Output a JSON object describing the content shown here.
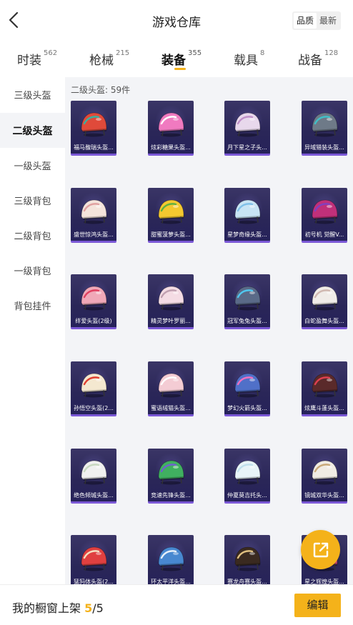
{
  "header": {
    "title": "游戏仓库",
    "sort_options": [
      "品质",
      "最新"
    ],
    "sort_active": "品质",
    "back_icon": "chevron-left-icon"
  },
  "tabs": [
    {
      "label": "时装",
      "count": "562",
      "active": false
    },
    {
      "label": "枪械",
      "count": "215",
      "active": false
    },
    {
      "label": "装备",
      "count": "355",
      "active": true
    },
    {
      "label": "载具",
      "count": "8",
      "active": false
    },
    {
      "label": "战备",
      "count": "128",
      "active": false
    }
  ],
  "sidebar": {
    "items": [
      {
        "label": "三级头盔",
        "active": false
      },
      {
        "label": "二级头盔",
        "active": true
      },
      {
        "label": "一级头盔",
        "active": false
      },
      {
        "label": "三级背包",
        "active": false
      },
      {
        "label": "二级背包",
        "active": false
      },
      {
        "label": "一级背包",
        "active": false
      },
      {
        "label": "背包挂件",
        "active": false
      }
    ]
  },
  "section": {
    "title": "二级头盔: 59件"
  },
  "items": [
    {
      "name": "福马馥瑞头盔...",
      "color": "#e04a3a",
      "accent": "#3ab0a0"
    },
    {
      "name": "炫彩糖果头盔...",
      "color": "#f07ac0",
      "accent": "#ffffff"
    },
    {
      "name": "月下星之子头...",
      "color": "#e8d8ec",
      "accent": "#c090c8"
    },
    {
      "name": "异域猎装头盔...",
      "color": "#6e7a88",
      "accent": "#40c0c8"
    },
    {
      "name": "盛世惊鸿头盔...",
      "color": "#f4e4dc",
      "accent": "#e0a0a0"
    },
    {
      "name": "甜蜜菠萝头盔...",
      "color": "#f4c830",
      "accent": "#60b040"
    },
    {
      "name": "星梦奇缘头盔...",
      "color": "#c8e4f4",
      "accent": "#80c0e8"
    },
    {
      "name": "初号机 觉醒V...",
      "color": "#c0307a",
      "accent": "#8040c0"
    },
    {
      "name": "绊爱头盔(2级)",
      "color": "#f0a8b8",
      "accent": "#e04060"
    },
    {
      "name": "精灵梦叶罗丽...",
      "color": "#f4dce4",
      "accent": "#c0a0b0"
    },
    {
      "name": "冠军兔兔头盔...",
      "color": "#5a6a88",
      "accent": "#50c8f0"
    },
    {
      "name": "白蛇盈舞头盔...",
      "color": "#f0ece8",
      "accent": "#d0b8b0"
    },
    {
      "name": "孙悟空头盔(2...",
      "color": "#f4e8d0",
      "accent": "#e04030"
    },
    {
      "name": "蜜语绒猫头盔...",
      "color": "#f4ccd4",
      "accent": "#ffffff"
    },
    {
      "name": "梦幻火箭头盔...",
      "color": "#5070c8",
      "accent": "#f070c0"
    },
    {
      "name": "炫鹰斗蓬头盔...",
      "color": "#5a2a2a",
      "accent": "#e04050"
    },
    {
      "name": "绝色倾城头盔...",
      "color": "#f0f0f0",
      "accent": "#c8d8c0"
    },
    {
      "name": "竞速先锋头盔...",
      "color": "#40b060",
      "accent": "#7060d0"
    },
    {
      "name": "仲夏莫吉托头...",
      "color": "#e8f4f8",
      "accent": "#c0e0ec"
    },
    {
      "name": "镜城双华头盔...",
      "color": "#f0ece4",
      "accent": "#c8a878"
    },
    {
      "name": "猛犸体头盔(2...",
      "color": "#e04040",
      "accent": "#f4e0c0"
    },
    {
      "name": "环太平洋头盔...",
      "color": "#4888d0",
      "accent": "#e8f0f8"
    },
    {
      "name": "赛龙舟赛头盔...",
      "color": "#3a2a20",
      "accent": "#e0c080"
    },
    {
      "name": "星之辉煌头盔...",
      "color": "#e05080",
      "accent": "#f4c060"
    }
  ],
  "bottom": {
    "label_prefix": "我的橱窗上架 ",
    "current": "5",
    "total": "/5",
    "edit_label": "编辑"
  },
  "fab": {
    "icon": "share-icon"
  }
}
